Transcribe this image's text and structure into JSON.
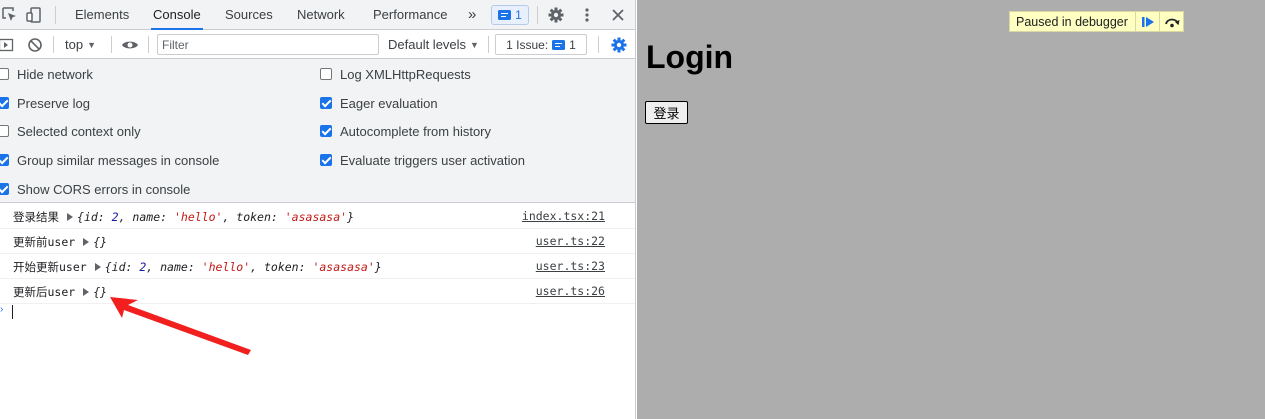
{
  "devtools": {
    "tabs": [
      "Elements",
      "Console",
      "Sources",
      "Network",
      "Performance"
    ],
    "active_tab": "Console",
    "more_tabs_glyph": "»",
    "messages_badge_count": "1",
    "icons": [
      "inspect-icon",
      "device-toolbar-icon",
      "messages-icon",
      "gear-icon",
      "kebab-menu-icon",
      "close-icon"
    ]
  },
  "console_toolbar": {
    "context": "top",
    "filter_placeholder": "Filter",
    "levels": "Default levels",
    "issues_label": "1 Issue:",
    "issues_count": "1"
  },
  "settings": {
    "left": [
      {
        "label": "Hide network",
        "checked": false
      },
      {
        "label": "Preserve log",
        "checked": true
      },
      {
        "label": "Selected context only",
        "checked": false
      },
      {
        "label": "Group similar messages in console",
        "checked": true
      },
      {
        "label": "Show CORS errors in console",
        "checked": true
      }
    ],
    "right": [
      {
        "label": "Log XMLHttpRequests",
        "checked": false
      },
      {
        "label": "Eager evaluation",
        "checked": true
      },
      {
        "label": "Autocomplete from history",
        "checked": true
      },
      {
        "label": "Evaluate triggers user activation",
        "checked": true
      }
    ]
  },
  "logs": [
    {
      "label": "登录结果",
      "obj": {
        "open": "{",
        "k1": "id: ",
        "v1": "2",
        "k2": ", name: ",
        "v2": "'hello'",
        "k3": ", token: ",
        "v3": "'asasasa'",
        "close": "}"
      },
      "source": "index.tsx:21"
    },
    {
      "label": "更新前user",
      "obj_text": "{}",
      "source": "user.ts:22"
    },
    {
      "label": "开始更新user",
      "obj": {
        "open": "{",
        "k1": "id: ",
        "v1": "2",
        "k2": ", name: ",
        "v2": "'hello'",
        "k3": ", token: ",
        "v3": "'asasasa'",
        "close": "}"
      },
      "source": "user.ts:23"
    },
    {
      "label": "更新后user",
      "obj_text": "{}",
      "source": "user.ts:26"
    }
  ],
  "page": {
    "heading": "Login",
    "button_label": "登录",
    "paused_text": "Paused in debugger"
  },
  "colors": {
    "accent": "#1a73e8",
    "page_bg": "#adadad",
    "string": "#c41a16",
    "number": "#1a1aa6",
    "annotation_arrow": "#f21f1f"
  }
}
